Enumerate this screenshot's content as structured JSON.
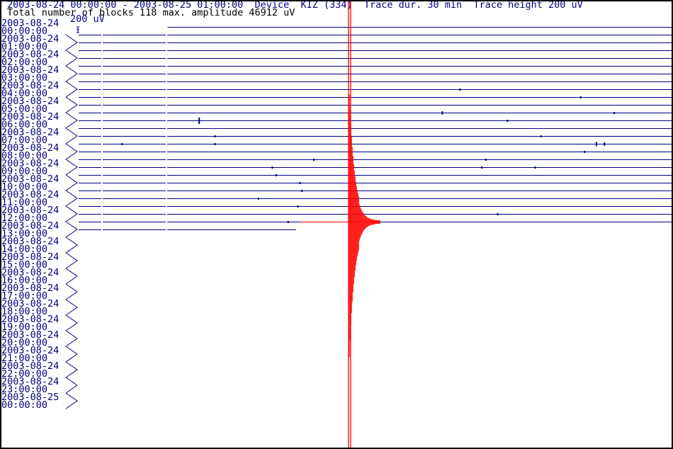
{
  "header": {
    "line1": "2003-08-24 00:00:00 - 2003-08-25 01:00:00  Device  KIZ (334)  Trace dur. 30 min  Trace height 200 uV",
    "line2": "Total number of blocks 118 max. amplitude 46912 uV",
    "scale_label": "200 uV"
  },
  "chart_data": {
    "type": "helicorder",
    "station": "KIZ (334)",
    "start": "2003-08-24 00:00:00",
    "end": "2003-08-25 01:00:00",
    "trace_duration_min": 30,
    "trace_height_uV": 200,
    "total_blocks": 118,
    "max_amplitude_uV": 46912,
    "trace_color": "#000080",
    "event_color": "#ff0000",
    "data_start_minute_first_trace": 4.5,
    "data_end_trace": "2003-08-24 13:00",
    "data_end_minute": 11,
    "hour_labels": [
      {
        "date": "2003-08-24",
        "time": "00:00:00"
      },
      {
        "date": "2003-08-24",
        "time": "01:00:00"
      },
      {
        "date": "2003-08-24",
        "time": "02:00:00"
      },
      {
        "date": "2003-08-24",
        "time": "03:00:00"
      },
      {
        "date": "2003-08-24",
        "time": "04:00:00"
      },
      {
        "date": "2003-08-24",
        "time": "05:00:00"
      },
      {
        "date": "2003-08-24",
        "time": "06:00:00"
      },
      {
        "date": "2003-08-24",
        "time": "07:00:00"
      },
      {
        "date": "2003-08-24",
        "time": "08:00:00"
      },
      {
        "date": "2003-08-24",
        "time": "09:00:00"
      },
      {
        "date": "2003-08-24",
        "time": "10:00:00"
      },
      {
        "date": "2003-08-24",
        "time": "11:00:00"
      },
      {
        "date": "2003-08-24",
        "time": "12:00:00"
      },
      {
        "date": "2003-08-24",
        "time": "13:00:00"
      },
      {
        "date": "2003-08-24",
        "time": "14:00:00"
      },
      {
        "date": "2003-08-24",
        "time": "15:00:00"
      },
      {
        "date": "2003-08-24",
        "time": "16:00:00"
      },
      {
        "date": "2003-08-24",
        "time": "17:00:00"
      },
      {
        "date": "2003-08-24",
        "time": "18:00:00"
      },
      {
        "date": "2003-08-24",
        "time": "19:00:00"
      },
      {
        "date": "2003-08-24",
        "time": "20:00:00"
      },
      {
        "date": "2003-08-24",
        "time": "21:00:00"
      },
      {
        "date": "2003-08-24",
        "time": "22:00:00"
      },
      {
        "date": "2003-08-24",
        "time": "23:00:00"
      },
      {
        "date": "2003-08-25",
        "time": "00:00:00"
      }
    ],
    "spikes": [
      {
        "trace": 8,
        "minute": 19.3,
        "amp_uV": 20
      },
      {
        "trace": 9,
        "minute": 25.4,
        "amp_uV": 20
      },
      {
        "trace": 11,
        "minute": 18.4,
        "amp_uV": 60
      },
      {
        "trace": 11,
        "minute": 27.1,
        "amp_uV": 20
      },
      {
        "trace": 12,
        "minute": 6.1,
        "amp_uV": 120
      },
      {
        "trace": 12,
        "minute": 21.7,
        "amp_uV": 20
      },
      {
        "trace": 14,
        "minute": 6.9,
        "amp_uV": 20
      },
      {
        "trace": 14,
        "minute": 23.4,
        "amp_uV": 20
      },
      {
        "trace": 15,
        "minute": 2.2,
        "amp_uV": 20
      },
      {
        "trace": 15,
        "minute": 6.9,
        "amp_uV": 20
      },
      {
        "trace": 15,
        "minute": 26.2,
        "amp_uV": 80
      },
      {
        "trace": 15,
        "minute": 26.6,
        "amp_uV": 60
      },
      {
        "trace": 16,
        "minute": 25.6,
        "amp_uV": 20
      },
      {
        "trace": 17,
        "minute": 11.9,
        "amp_uV": 20
      },
      {
        "trace": 17,
        "minute": 20.6,
        "amp_uV": 20
      },
      {
        "trace": 18,
        "minute": 9.8,
        "amp_uV": 30
      },
      {
        "trace": 18,
        "minute": 20.4,
        "amp_uV": 40
      },
      {
        "trace": 18,
        "minute": 23.1,
        "amp_uV": 20
      },
      {
        "trace": 19,
        "minute": 10.0,
        "amp_uV": 30
      },
      {
        "trace": 20,
        "minute": 11.2,
        "amp_uV": 20
      },
      {
        "trace": 21,
        "minute": 11.3,
        "amp_uV": 30
      },
      {
        "trace": 22,
        "minute": 9.1,
        "amp_uV": 20
      },
      {
        "trace": 23,
        "minute": 11.1,
        "amp_uV": 30
      },
      {
        "trace": 24,
        "minute": 21.2,
        "amp_uV": 30
      },
      {
        "trace": 25,
        "minute": 10.6,
        "amp_uV": 20
      }
    ],
    "event": {
      "trace": 25,
      "trace_start": "2003-08-24 12:30",
      "minute": 13.7,
      "amp_uV": 46912
    }
  }
}
